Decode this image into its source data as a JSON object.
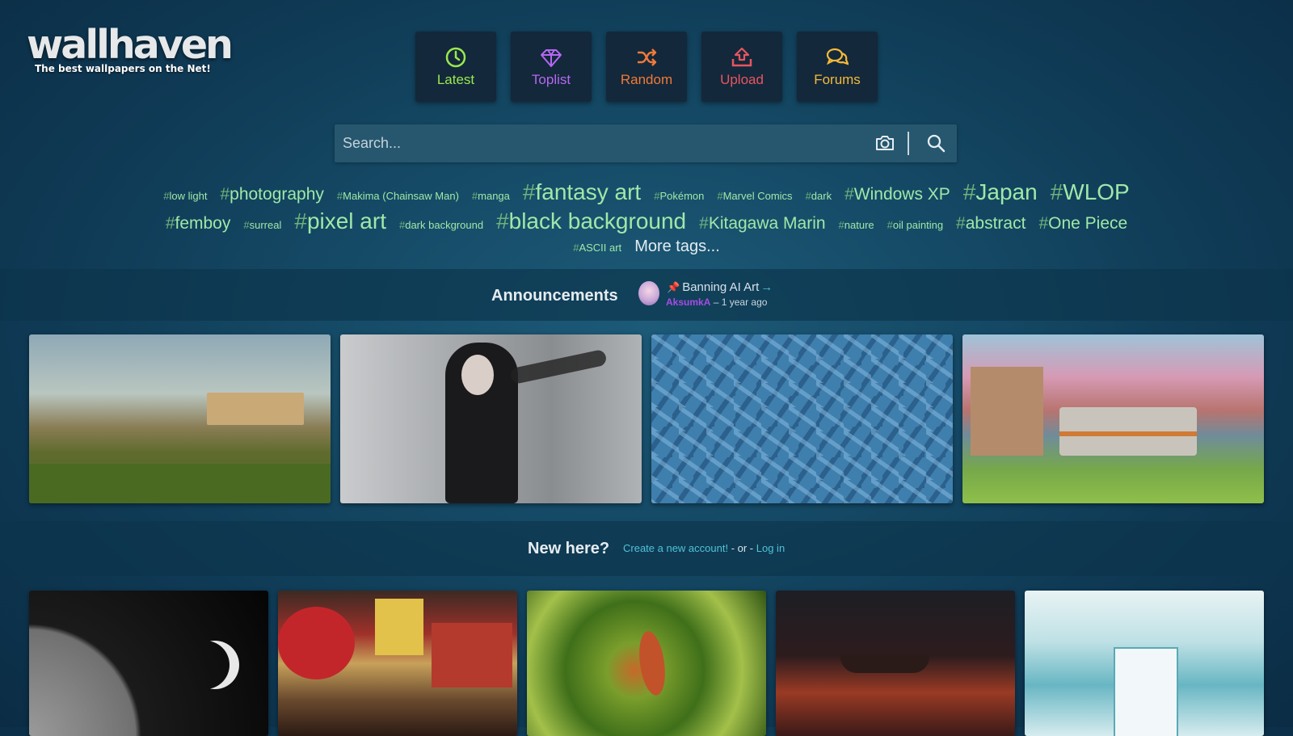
{
  "logo": {
    "title": "wallhaven",
    "tagline": "The best wallpapers on the Net!"
  },
  "nav": [
    {
      "label": "Latest",
      "icon": "clock-icon",
      "color": "#9be84f"
    },
    {
      "label": "Toplist",
      "icon": "diamond-icon",
      "color": "#b667f2"
    },
    {
      "label": "Random",
      "icon": "shuffle-icon",
      "color": "#f07a38"
    },
    {
      "label": "Upload",
      "icon": "upload-icon",
      "color": "#e8555f"
    },
    {
      "label": "Forums",
      "icon": "chat-icon",
      "color": "#f5b93a"
    }
  ],
  "search": {
    "placeholder": "Search..."
  },
  "tags": {
    "rows": [
      [
        {
          "text": "low light",
          "size": "sm"
        },
        {
          "text": "photography",
          "size": "md"
        },
        {
          "text": "Makima (Chainsaw Man)",
          "size": "sm"
        },
        {
          "text": "manga",
          "size": "sm"
        },
        {
          "text": "fantasy art",
          "size": "lg"
        },
        {
          "text": "Pokémon",
          "size": "sm"
        },
        {
          "text": "Marvel Comics",
          "size": "sm"
        },
        {
          "text": "dark",
          "size": "sm"
        },
        {
          "text": "Windows XP",
          "size": "md"
        },
        {
          "text": "Japan",
          "size": "lg"
        },
        {
          "text": "WLOP",
          "size": "lg"
        }
      ],
      [
        {
          "text": "femboy",
          "size": "md"
        },
        {
          "text": "surreal",
          "size": "sm"
        },
        {
          "text": "pixel art",
          "size": "lg"
        },
        {
          "text": "dark background",
          "size": "sm"
        },
        {
          "text": "black background",
          "size": "lg"
        },
        {
          "text": "Kitagawa Marin",
          "size": "md"
        },
        {
          "text": "nature",
          "size": "sm"
        },
        {
          "text": "oil painting",
          "size": "sm"
        },
        {
          "text": "abstract",
          "size": "md"
        },
        {
          "text": "One Piece",
          "size": "md"
        }
      ],
      [
        {
          "text": "ASCII art",
          "size": "sm"
        }
      ]
    ],
    "more": "More tags..."
  },
  "announcement": {
    "heading": "Announcements",
    "title": "Banning AI Art",
    "user": "AksumkA",
    "time": "– 1 year ago"
  },
  "new_here": {
    "heading": "New here?",
    "create": "Create a new account!",
    "or": " - or - ",
    "login": "Log in"
  },
  "featured_wallpapers": [
    {
      "name": "landscape-painting"
    },
    {
      "name": "woman-black-hair"
    },
    {
      "name": "blue-mosaic"
    },
    {
      "name": "anime-train-cherry-blossom"
    }
  ],
  "latest_wallpapers": [
    {
      "name": "moon"
    },
    {
      "name": "piccadilly-circus-coca-cola"
    },
    {
      "name": "hummingbird"
    },
    {
      "name": "boat-sunset"
    },
    {
      "name": "library-interior"
    }
  ],
  "colors": {
    "tag_green": "#9fe8a8",
    "link_cyan": "#4fc3d6",
    "user_purple": "#a64ce4"
  }
}
